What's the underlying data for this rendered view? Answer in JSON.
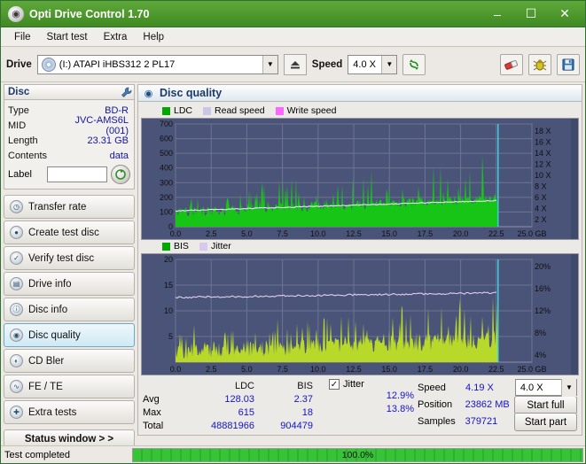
{
  "window": {
    "title": "Opti Drive Control 1.70",
    "icon": "disc-icon",
    "minimize": "–",
    "maximize": "☐",
    "close": "✕"
  },
  "menu": [
    {
      "label": "File"
    },
    {
      "label": "Start test"
    },
    {
      "label": "Extra"
    },
    {
      "label": "Help"
    }
  ],
  "drivebar": {
    "drive_label": "Drive",
    "drive_value": "(I:)  ATAPI iHBS312   2 PL17",
    "speed_label": "Speed",
    "speed_value": "4.0 X",
    "eject_icon": "eject-icon",
    "refresh_icon": "refresh-icon",
    "erase_icon": "eraser-icon",
    "info_icon": "bug-icon",
    "save_icon": "save-icon"
  },
  "disc_panel": {
    "title": "Disc",
    "header_icon": "wrench-icon",
    "rows": [
      {
        "key": "Type",
        "value": "BD-R"
      },
      {
        "key": "MID",
        "value": "JVC-AMS6L (001)"
      },
      {
        "key": "Length",
        "value": "23.31 GB"
      },
      {
        "key": "Contents",
        "value": "data"
      }
    ],
    "label_key": "Label",
    "label_value": "",
    "label_button_icon": "disc-refresh-icon"
  },
  "sidebar": {
    "items": [
      {
        "label": "Transfer rate",
        "icon": "gauge-icon",
        "active": false
      },
      {
        "label": "Create test disc",
        "icon": "disc-write-icon",
        "active": false
      },
      {
        "label": "Verify test disc",
        "icon": "check-disc-icon",
        "active": false
      },
      {
        "label": "Drive info",
        "icon": "drive-icon",
        "active": false
      },
      {
        "label": "Disc info",
        "icon": "disc-info-icon",
        "active": false
      },
      {
        "label": "Disc quality",
        "icon": "quality-icon",
        "active": true
      },
      {
        "label": "CD Bler",
        "icon": "cd-icon",
        "active": false
      },
      {
        "label": "FE / TE",
        "icon": "wave-icon",
        "active": false
      },
      {
        "label": "Extra tests",
        "icon": "extra-icon",
        "active": false
      }
    ],
    "status_window": "Status window > >"
  },
  "disc_quality": {
    "title": "Disc quality",
    "icon": "quality-icon",
    "legend_top": [
      {
        "label": "LDC",
        "color": "#00a800"
      },
      {
        "label": "Read speed",
        "color": "#c8c8e6"
      },
      {
        "label": "Write speed",
        "color": "#ff66ff"
      }
    ],
    "legend_bottom": [
      {
        "label": "BIS",
        "color": "#00a800"
      },
      {
        "label": "Jitter",
        "color": "#d8c8f0"
      }
    ]
  },
  "chart_data": [
    {
      "type": "area",
      "title": "LDC",
      "xlabel": "GB",
      "ylabel": "LDC",
      "x_ticks": [
        "0.0",
        "2.5",
        "5.0",
        "7.5",
        "10.0",
        "12.5",
        "15.0",
        "17.5",
        "20.0",
        "22.5",
        "25.0 GB"
      ],
      "y_ticks": [
        0,
        100,
        200,
        300,
        400,
        500,
        600,
        700
      ],
      "ylim": [
        0,
        700
      ],
      "xlim": [
        0,
        25
      ],
      "right_axis_ticks": [
        "18 X",
        "16 X",
        "14 X",
        "12 X",
        "10 X",
        "8 X",
        "6 X",
        "4 X",
        "2 X"
      ],
      "right_axis_label": "speed",
      "series": [
        {
          "name": "LDC",
          "color": "#00c000",
          "avg": 128.03,
          "max": 615,
          "total": 48881966
        },
        {
          "name": "Read speed",
          "color": "#c8c8e6"
        },
        {
          "name": "Write speed",
          "color": "#ff66ff"
        }
      ],
      "grid": true
    },
    {
      "type": "area",
      "title": "BIS",
      "xlabel": "GB",
      "ylabel": "BIS",
      "x_ticks": [
        "0.0",
        "2.5",
        "5.0",
        "7.5",
        "10.0",
        "12.5",
        "15.0",
        "17.5",
        "20.0",
        "22.5",
        "25.0 GB"
      ],
      "y_ticks": [
        5,
        10,
        15,
        20
      ],
      "ylim": [
        0,
        20
      ],
      "xlim": [
        0,
        25
      ],
      "right_axis_ticks": [
        "20%",
        "16%",
        "12%",
        "8%",
        "4%"
      ],
      "right_axis_label": "jitter",
      "series": [
        {
          "name": "BIS",
          "color": "#9fd000",
          "avg": 2.37,
          "max": 18,
          "total": 904479
        },
        {
          "name": "Jitter",
          "color": "#d8c8f0",
          "avg": "12.9%",
          "max": "13.8%"
        }
      ],
      "grid": true
    }
  ],
  "stats": {
    "col_headers": {
      "ldc": "LDC",
      "bis": "BIS"
    },
    "rows": [
      {
        "name": "Avg",
        "ldc": "128.03",
        "bis": "2.37"
      },
      {
        "name": "Max",
        "ldc": "615",
        "bis": "18"
      },
      {
        "name": "Total",
        "ldc": "48881966",
        "bis": "904479"
      }
    ],
    "jitter": {
      "label": "Jitter",
      "checked": true,
      "avg": "12.9%",
      "max": "13.8%"
    },
    "right": {
      "speed_label": "Speed",
      "speed_value": "4.19 X",
      "speed_combo": "4.0 X",
      "position_label": "Position",
      "position_value": "23862 MB",
      "samples_label": "Samples",
      "samples_value": "379721",
      "start_full": "Start full",
      "start_part": "Start part"
    }
  },
  "statusbar": {
    "text": "Test completed",
    "progress": "100.0%",
    "progress_pct": 100
  }
}
